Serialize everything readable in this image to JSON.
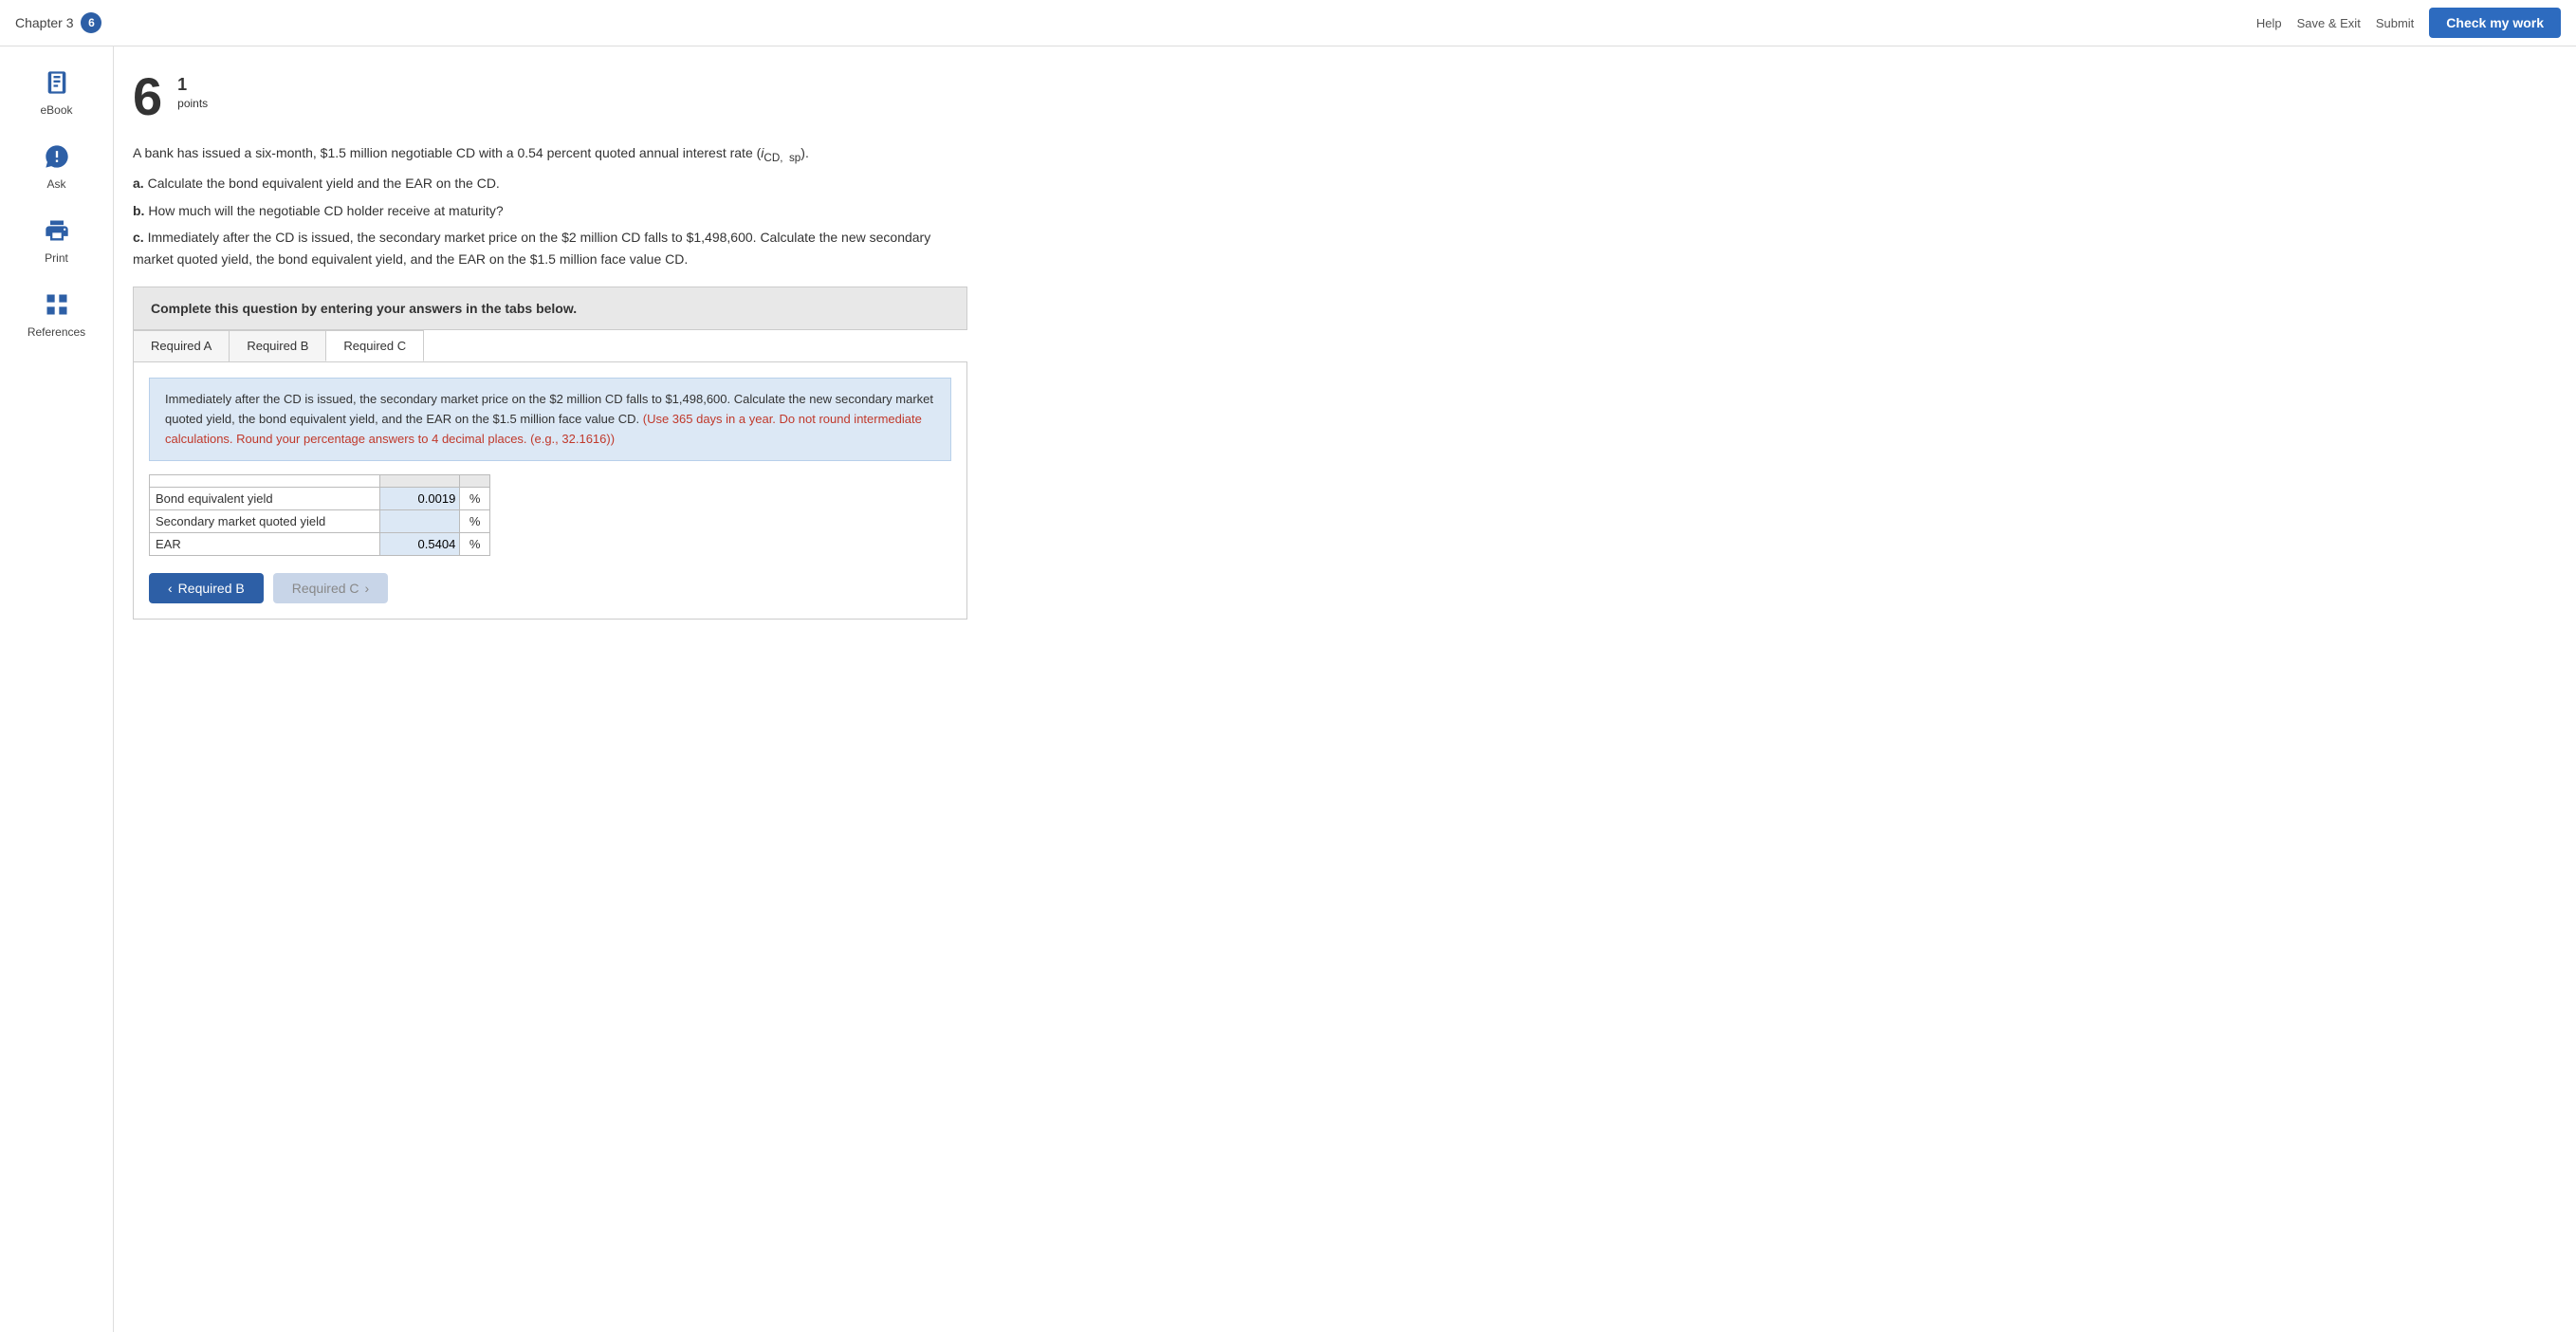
{
  "header": {
    "chapter_label": "Chapter 3",
    "chapter_badge": "6",
    "help_link": "Help",
    "save_link": "Save & Exit",
    "submit_link": "Submit",
    "check_button": "Check my work"
  },
  "sidebar": {
    "items": [
      {
        "id": "ebook",
        "label": "eBook",
        "icon": "book"
      },
      {
        "id": "ask",
        "label": "Ask",
        "icon": "chat"
      },
      {
        "id": "print",
        "label": "Print",
        "icon": "print"
      },
      {
        "id": "references",
        "label": "References",
        "icon": "grid"
      }
    ]
  },
  "question": {
    "number": "6",
    "points_value": "1",
    "points_label": "points",
    "body_text": "A bank has issued a six-month, $1.5 million negotiable CD with a 0.54 percent quoted annual interest rate (i",
    "subscript": "CD,  sp",
    "body_end": ").",
    "parts": [
      "a. Calculate the bond equivalent yield and the EAR on the CD.",
      "b. How much will the negotiable CD holder receive at maturity?",
      "c. Immediately after the CD is issued, the secondary market price on the $2 million CD falls to $1,498,600. Calculate the new secondary market quoted yield, the bond equivalent yield, and the EAR on the $1.5 million face value CD."
    ]
  },
  "instruction_box": {
    "text": "Complete this question by entering your answers in the tabs below."
  },
  "tabs": [
    {
      "id": "required-a",
      "label": "Required A"
    },
    {
      "id": "required-b",
      "label": "Required B"
    },
    {
      "id": "required-c",
      "label": "Required C",
      "active": true
    }
  ],
  "tab_c": {
    "description_main": "Immediately after the CD is issued, the secondary market price on the $2 million CD falls to $1,498,600. Calculate the new secondary market quoted yield, the bond equivalent yield, and the EAR on the $1.5 million face value CD.",
    "description_note": "(Use 365 days in a year. Do not round intermediate calculations. Round your percentage answers to 4 decimal places. (e.g., 32.1616))",
    "table": {
      "rows": [
        {
          "label": "Bond equivalent yield",
          "value": "0.0019",
          "unit": "%"
        },
        {
          "label": "Secondary market quoted yield",
          "value": "",
          "unit": "%"
        },
        {
          "label": "EAR",
          "value": "0.5404",
          "unit": "%"
        }
      ]
    }
  },
  "nav_buttons": {
    "back_label": "Required B",
    "next_label": "Required C"
  }
}
